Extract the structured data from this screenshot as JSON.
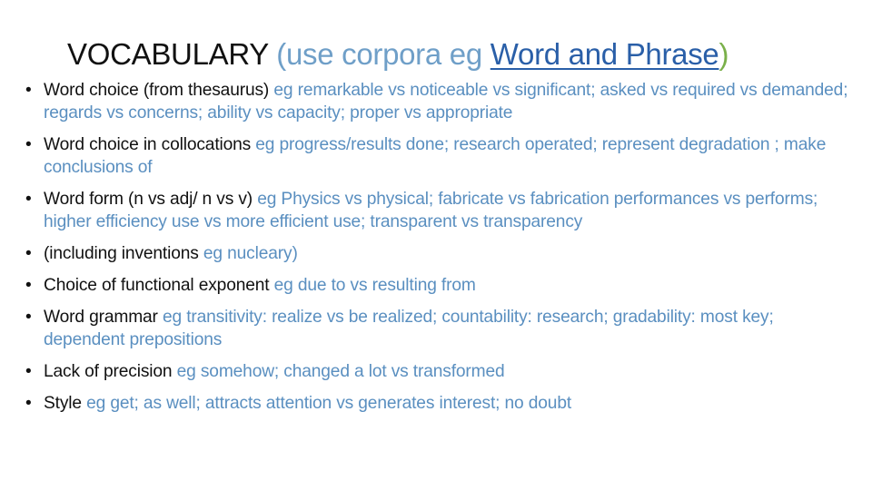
{
  "title": {
    "main": "VOCABULARY",
    "aside_prefix": "(use corpora eg ",
    "link": "Word and Phrase",
    "aside_suffix": ")"
  },
  "colors": {
    "heading_text": "#111111",
    "example_text": "#5a8fc0",
    "link": "#2a5fa8",
    "title_aside": "#6f9fc8",
    "closing_paren": "#7ab04a"
  },
  "bullets": [
    {
      "topic": "Word choice (from thesaurus)",
      "examples": "eg remarkable vs noticeable vs significant; asked vs required vs demanded; regards vs concerns; ability vs capacity; proper vs appropriate"
    },
    {
      "topic": "Word choice in collocations",
      "examples": "eg progress/results done; research operated; represent degradation ; make conclusions of"
    },
    {
      "topic": "Word form (n vs adj/ n vs v)",
      "examples": "eg Physics vs physical; fabricate vs fabrication performances vs performs; higher efficiency use vs more efficient use; transparent vs transparency"
    },
    {
      "topic": "(including inventions",
      "examples": "eg nucleary)"
    },
    {
      "topic": "Choice of functional exponent",
      "examples": "eg due to  vs resulting from"
    },
    {
      "topic": "Word grammar",
      "examples": "eg transitivity: realize vs be realized; countability: research; gradability: most key; dependent prepositions"
    },
    {
      "topic": "Lack of precision",
      "examples": "eg somehow; changed a lot vs transformed"
    },
    {
      "topic": "Style",
      "examples": "eg get; as well; attracts attention vs generates interest; no doubt"
    }
  ],
  "bullet_glyph": "•"
}
